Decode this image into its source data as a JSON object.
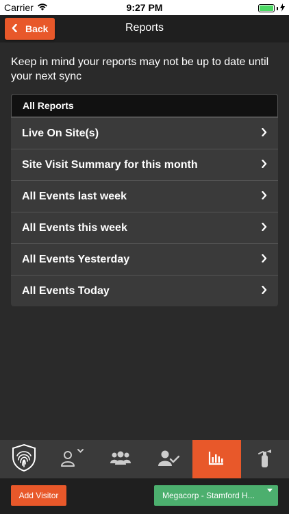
{
  "status_bar": {
    "carrier": "Carrier",
    "time": "9:27 PM",
    "wifi_icon": "wifi-icon",
    "battery_icon": "battery-icon",
    "charging_icon": "bolt-icon"
  },
  "nav": {
    "back_label": "Back",
    "title": "Reports"
  },
  "notice": "Keep in mind your reports may not be up to date until your next sync",
  "reports": {
    "header": "All Reports",
    "items": [
      {
        "label": "Live On Site(s)"
      },
      {
        "label": "Site Visit Summary for this month"
      },
      {
        "label": "All Events last week"
      },
      {
        "label": "All Events this week"
      },
      {
        "label": "All Events Yesterday"
      },
      {
        "label": "All Events Today"
      }
    ]
  },
  "tabs": [
    {
      "icon": "fingerprint-shield-icon",
      "active": false
    },
    {
      "icon": "user-dropdown-icon",
      "active": false
    },
    {
      "icon": "group-icon",
      "active": false
    },
    {
      "icon": "user-check-icon",
      "active": false
    },
    {
      "icon": "bar-chart-icon",
      "active": true
    },
    {
      "icon": "fire-extinguisher-icon",
      "active": false
    }
  ],
  "bottom": {
    "add_visitor_label": "Add Visitor",
    "site_label": "Megacorp - Stamford H..."
  },
  "colors": {
    "accent": "#e8582a",
    "site_green": "#4caf6e",
    "background": "#2a2a2a"
  }
}
